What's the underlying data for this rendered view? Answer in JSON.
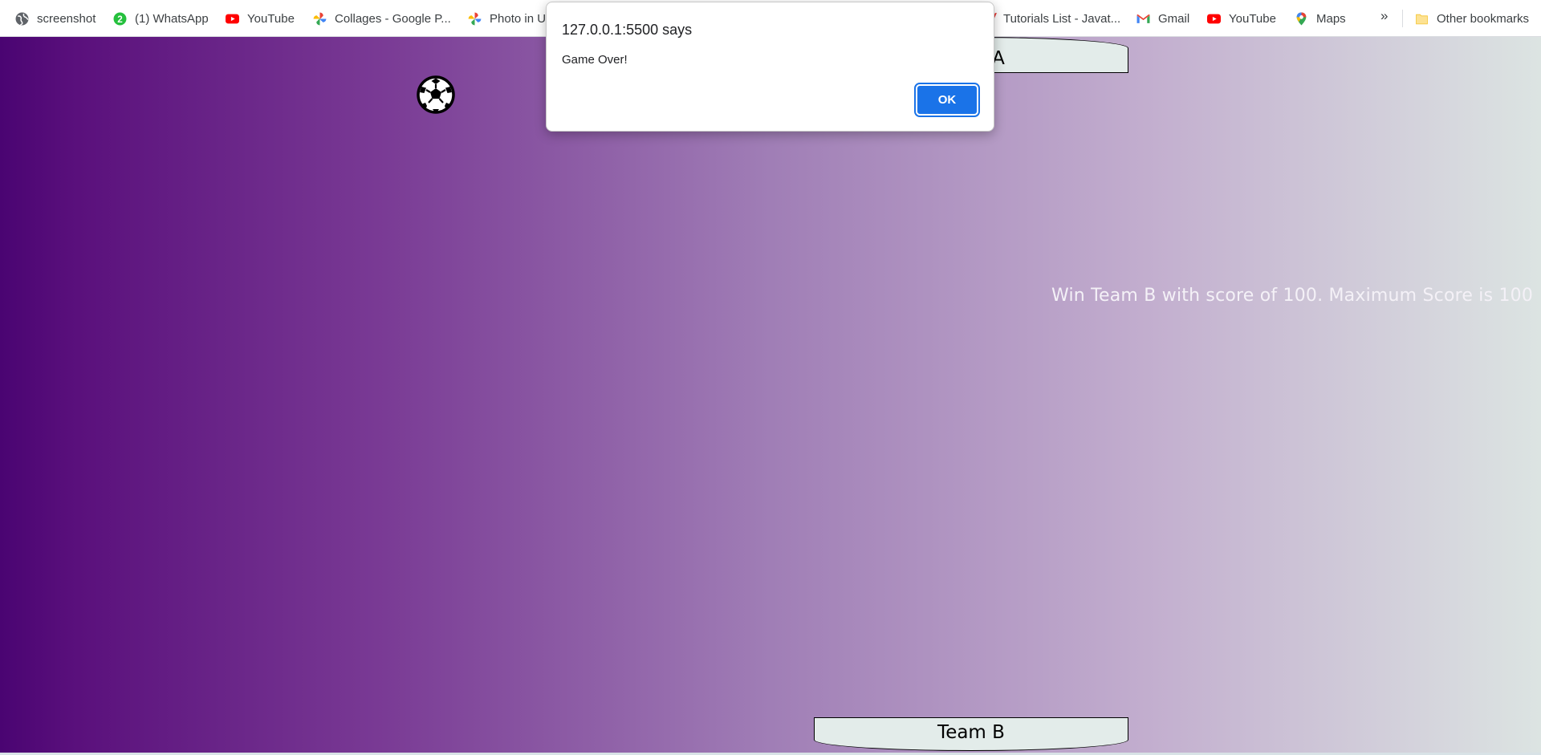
{
  "bookmarks": {
    "items": [
      {
        "label": "screenshot",
        "icon": "globe-icon"
      },
      {
        "label": "(1) WhatsApp",
        "icon": "whatsapp-icon",
        "badge": "2"
      },
      {
        "label": "YouTube",
        "icon": "youtube-icon"
      },
      {
        "label": "Collages - Google P...",
        "icon": "google-photos-icon"
      },
      {
        "label": "Photo in U",
        "icon": "google-photos-icon"
      },
      {
        "label": "Tutorials List - Javat...",
        "icon": "javatpoint-icon"
      },
      {
        "label": "Gmail",
        "icon": "gmail-icon"
      },
      {
        "label": "YouTube",
        "icon": "youtube-icon"
      },
      {
        "label": "Maps",
        "icon": "maps-pin-icon"
      }
    ],
    "overflow_label": "»",
    "other_bookmarks": {
      "label": "Other bookmarks",
      "icon": "folder-icon"
    }
  },
  "game": {
    "team_a_label": "Team A",
    "team_b_label": "Team B",
    "win_message": "Win Team B with score of 100. Maximum Score is 100",
    "ball_icon": "soccer-ball-icon",
    "background_colors": [
      "#4a0472",
      "#a07eb6",
      "#dce4e2"
    ]
  },
  "dialog": {
    "title": "127.0.0.1:5500 says",
    "message": "Game Over!",
    "ok_label": "OK",
    "accent": "#1a73e8"
  }
}
